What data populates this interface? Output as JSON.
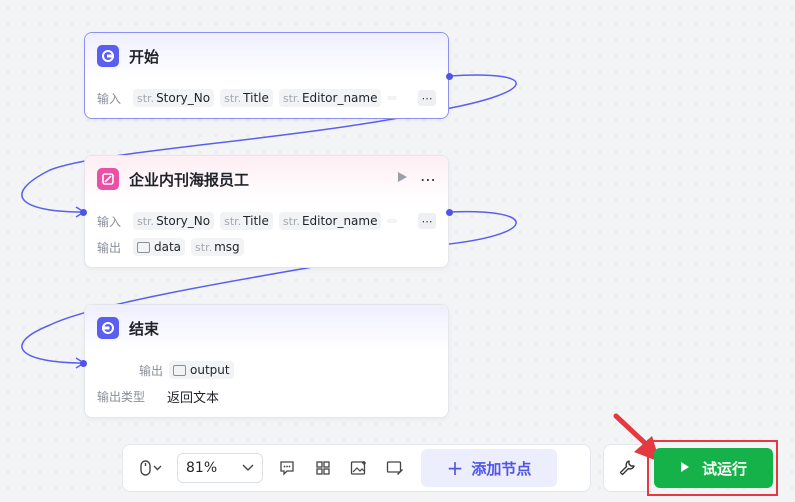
{
  "nodes": {
    "start": {
      "title": "开始",
      "input_label": "输入",
      "inputs": [
        {
          "type": "str.",
          "name": "Story_No"
        },
        {
          "type": "str.",
          "name": "Title"
        },
        {
          "type": "str.",
          "name": "Editor_name"
        }
      ],
      "more": "⋯"
    },
    "plugin": {
      "title": "企业内刊海报员工",
      "input_label": "输入",
      "inputs": [
        {
          "type": "str.",
          "name": "Story_No"
        },
        {
          "type": "str.",
          "name": "Title"
        },
        {
          "type": "str.",
          "name": "Editor_name"
        }
      ],
      "output_label": "输出",
      "outputs": [
        {
          "type": "image",
          "name": "data"
        },
        {
          "type": "str.",
          "name": "msg"
        }
      ],
      "more": "⋯",
      "menu": "⋯"
    },
    "end": {
      "title": "结束",
      "output_label": "输出",
      "output": {
        "type": "image",
        "name": "output"
      },
      "output_type_label": "输出类型",
      "output_type_value": "返回文本"
    }
  },
  "toolbar": {
    "zoom": "81%",
    "add_node": "添加节点",
    "add_icon": "+"
  },
  "run_button": "试运行",
  "colors": {
    "accent": "#4f55e6",
    "node_icon_blue": "#5a5ff0",
    "node_icon_pink": "#ec4fa6",
    "run_green": "#15b24a",
    "highlight_red": "#e5393f"
  },
  "icons": [
    "start-node-icon",
    "plugin-node-icon",
    "end-node-icon",
    "mouse-icon",
    "chevron-down-icon",
    "comment-icon",
    "grid-icon",
    "image-icon",
    "note-icon",
    "plus-icon",
    "wrench-icon",
    "play-icon"
  ]
}
